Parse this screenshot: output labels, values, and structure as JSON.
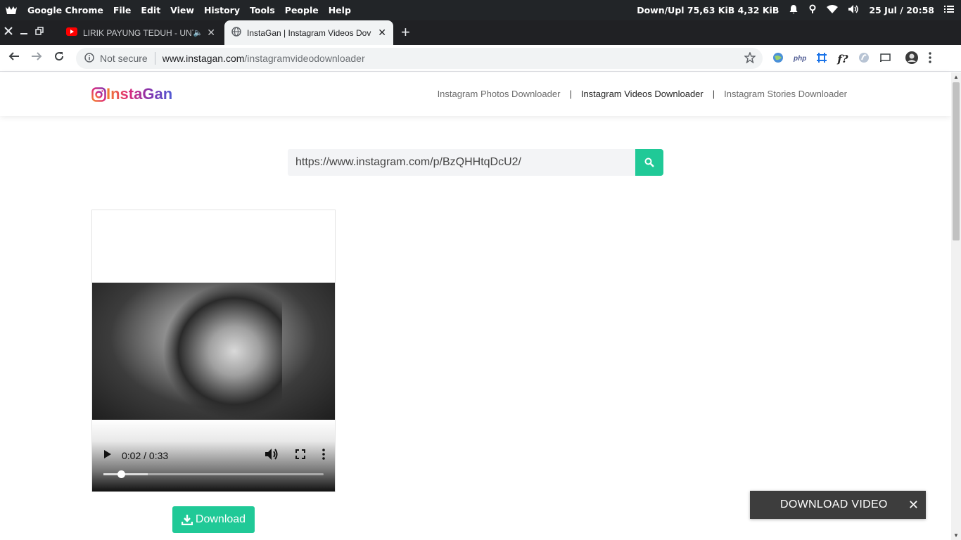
{
  "system": {
    "app_name": "Google Chrome",
    "menu": [
      "File",
      "Edit",
      "View",
      "History",
      "Tools",
      "People",
      "Help"
    ],
    "network_label": "Down/Upl",
    "network_down": "75,63 KiB",
    "network_up": "4,32 KiB",
    "datetime": "25 Jul / 20:58"
  },
  "tabs": [
    {
      "title": "LIRIK PAYUNG TEDUH - UNT",
      "active": false
    },
    {
      "title": "InstaGan | Instagram Videos Dov",
      "active": true
    }
  ],
  "address": {
    "security": "Not secure",
    "host": "www.instagan.com",
    "path": "/instagramvideodownloader"
  },
  "site": {
    "brand": "InstaGan",
    "nav": [
      {
        "label": "Instagram Photos Downloader",
        "active": false
      },
      {
        "label": "Instagram Videos Downloader",
        "active": true
      },
      {
        "label": "Instagram Stories Downloader",
        "active": false
      }
    ],
    "separator": "|",
    "search_value": "https://www.instagram.com/p/BzQHHtqDcU2/"
  },
  "player": {
    "time": "0:02 / 0:33",
    "progress": 0.08,
    "buffered": 0.2
  },
  "download_label": "Download",
  "toast": {
    "label": "DOWNLOAD VIDEO",
    "close": "✕"
  },
  "colors": {
    "accent": "#20c997",
    "toast_bg": "#3d3d3d"
  }
}
